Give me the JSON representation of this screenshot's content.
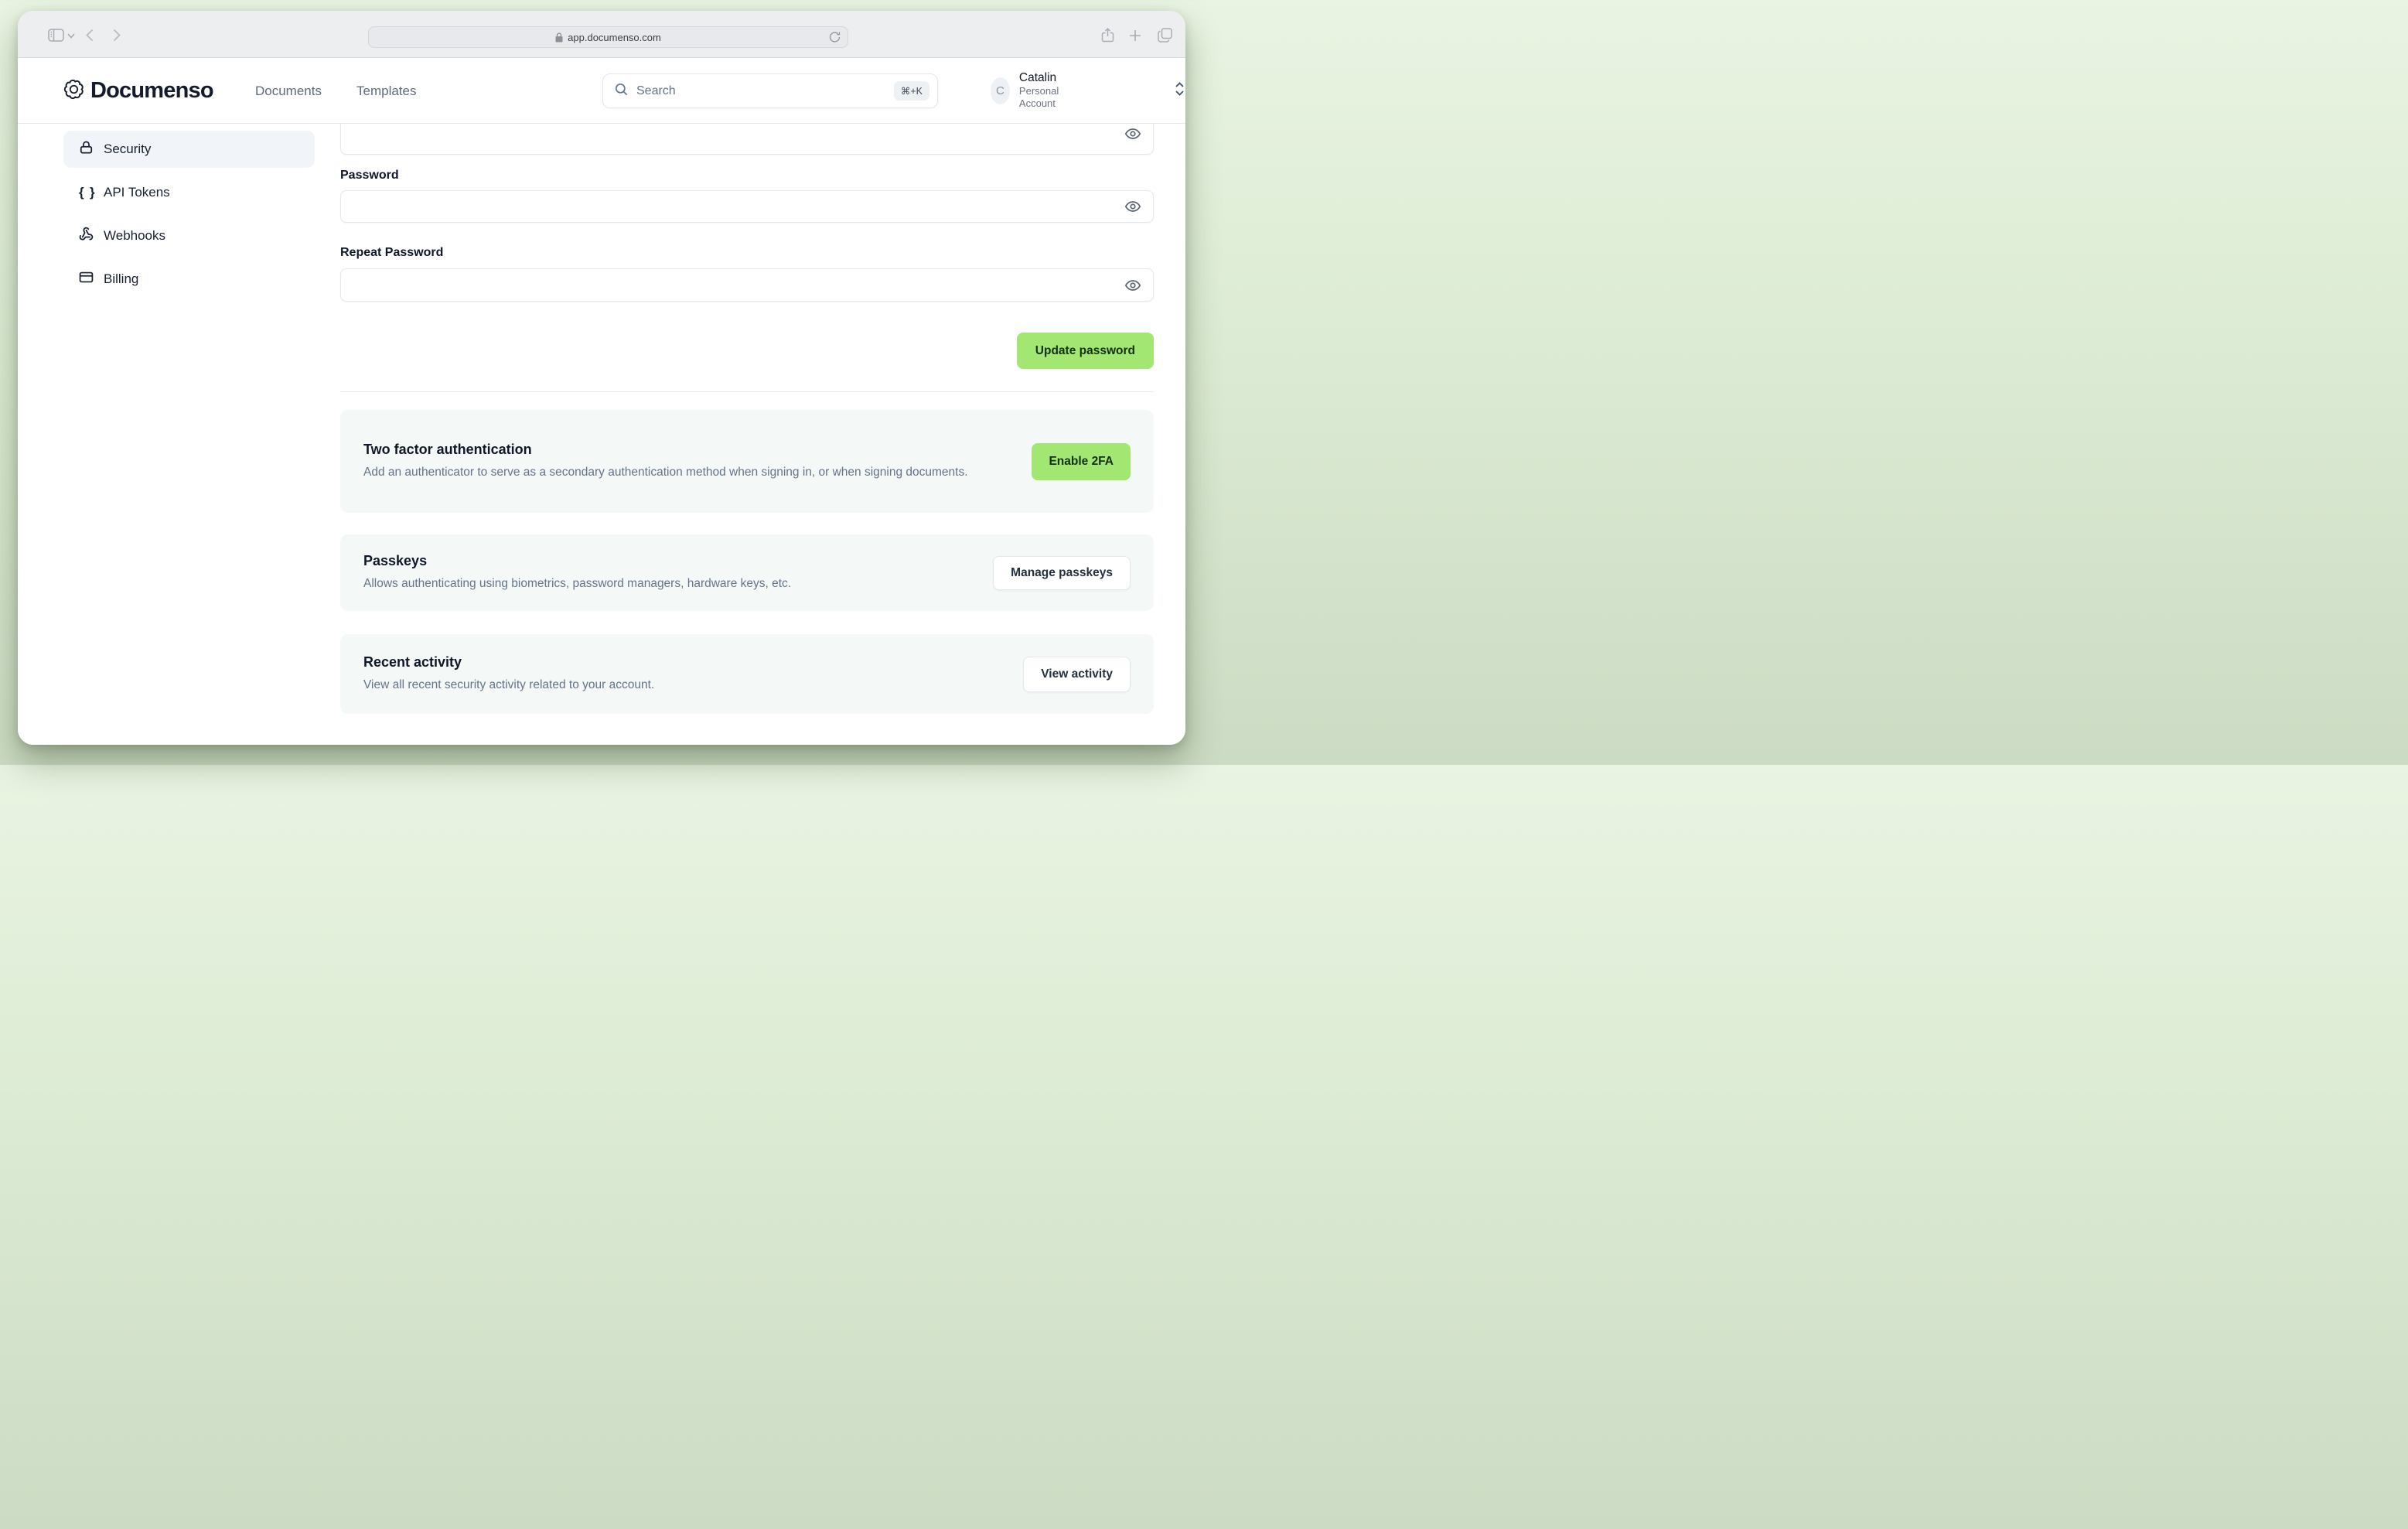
{
  "browser": {
    "url": "app.documenso.com"
  },
  "header": {
    "brand": "Documenso",
    "nav": {
      "documents": "Documents",
      "templates": "Templates"
    },
    "search": {
      "placeholder": "Search",
      "shortcut": "⌘+K"
    },
    "user": {
      "initial": "C",
      "name": "Catalin",
      "account_type": "Personal Account"
    }
  },
  "sidebar": {
    "items": [
      {
        "label": "Security",
        "icon": "lock"
      },
      {
        "label": "API Tokens",
        "icon": "braces"
      },
      {
        "label": "Webhooks",
        "icon": "webhook"
      },
      {
        "label": "Billing",
        "icon": "credit-card"
      }
    ]
  },
  "password_form": {
    "password_label": "Password",
    "repeat_password_label": "Repeat Password",
    "password_value": "",
    "repeat_password_value": "",
    "submit_label": "Update password"
  },
  "sections": [
    {
      "title": "Two factor authentication",
      "description": "Add an authenticator to serve as a secondary authentication method when signing in, or when signing documents.",
      "button": "Enable 2FA"
    },
    {
      "title": "Passkeys",
      "description": "Allows authenticating using biometrics, password managers, hardware keys, etc.",
      "button": "Manage passkeys"
    },
    {
      "title": "Recent activity",
      "description": "View all recent security activity related to your account.",
      "button": "View activity"
    }
  ],
  "colors": {
    "accent_green": "#a2e771",
    "accent_text": "#16300a",
    "card_bg": "#f4f8f7",
    "active_item_bg": "#f1f4f8",
    "desktop_top": "#e9f4e2",
    "desktop_bottom": "#ccdbc3"
  }
}
